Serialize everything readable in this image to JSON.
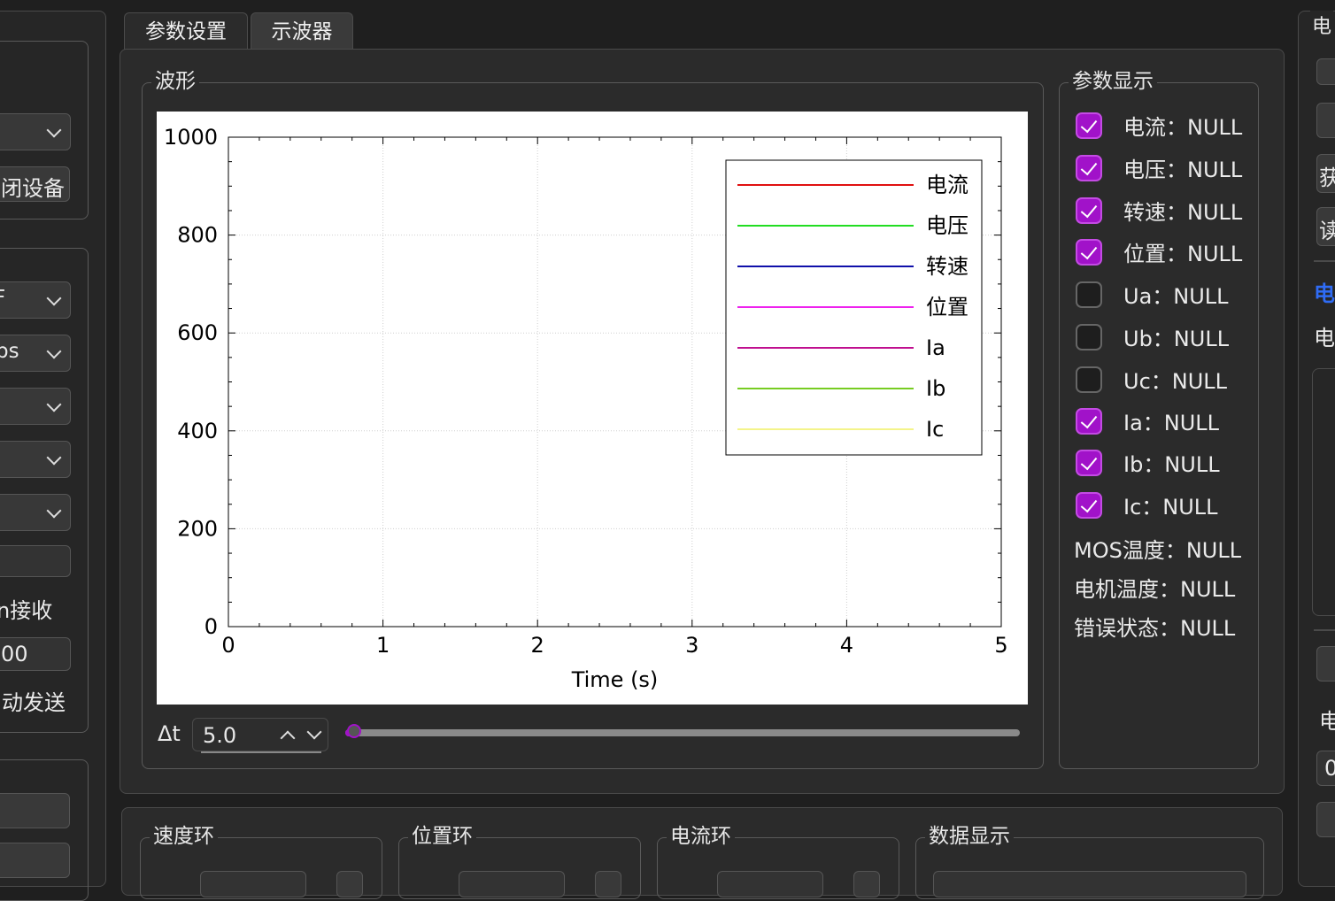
{
  "tabs": [
    "参数设置",
    "示波器"
  ],
  "left_panel": {
    "open_device_label": "闭设备",
    "combo_values": [
      "",
      "F",
      "ps",
      "",
      "",
      ""
    ],
    "receive_label": "n接收",
    "send_value": "00",
    "auto_send_label": "动发送"
  },
  "waveform": {
    "title": "波形",
    "delta_label": "Δt",
    "delta_value": "5.0",
    "slider_fraction": 0.0
  },
  "chart_data": {
    "type": "line",
    "title": "",
    "xlabel": "Time (s)",
    "ylabel": "",
    "xlim": [
      0,
      5
    ],
    "ylim": [
      0,
      1000
    ],
    "x_ticks": [
      "0",
      "1",
      "2",
      "3",
      "4",
      "5"
    ],
    "y_ticks": [
      "0",
      "200",
      "400",
      "600",
      "800",
      "1000"
    ],
    "grid": true,
    "legend_position": "top-right",
    "series": [
      {
        "name": "电流",
        "color": "#e01010",
        "values": []
      },
      {
        "name": "电压",
        "color": "#22dd22",
        "values": []
      },
      {
        "name": "转速",
        "color": "#1010aa",
        "values": []
      },
      {
        "name": "位置",
        "color": "#ee22ee",
        "values": []
      },
      {
        "name": "Ia",
        "color": "#c0108f",
        "values": []
      },
      {
        "name": "Ib",
        "color": "#77cc22",
        "values": []
      },
      {
        "name": "Ic",
        "color": "#f4f48a",
        "values": []
      }
    ]
  },
  "params": {
    "title": "参数显示",
    "checkbox_items": [
      {
        "label": "电流：NULL",
        "checked": true
      },
      {
        "label": "电压：NULL",
        "checked": true
      },
      {
        "label": "转速：NULL",
        "checked": true
      },
      {
        "label": "位置：NULL",
        "checked": true
      },
      {
        "label": "Ua：NULL",
        "checked": false
      },
      {
        "label": "Ub：NULL",
        "checked": false
      },
      {
        "label": "Uc：NULL",
        "checked": false
      },
      {
        "label": "Ia：NULL",
        "checked": true
      },
      {
        "label": "Ib：NULL",
        "checked": true
      },
      {
        "label": "Ic：NULL",
        "checked": true
      }
    ],
    "text_items": [
      "MOS温度：NULL",
      "电机温度：NULL",
      "错误状态：NULL"
    ]
  },
  "bottom_groups": [
    "速度环",
    "位置环",
    "电流环",
    "数据显示"
  ],
  "right_panel": {
    "title": "电",
    "get_label": "获",
    "read_label": "读",
    "blue_label": "电",
    "label2": "电",
    "label3": "电",
    "value": "0"
  },
  "colors": {
    "accent": "#a112c9",
    "blue_text": "#2f6cf5"
  }
}
